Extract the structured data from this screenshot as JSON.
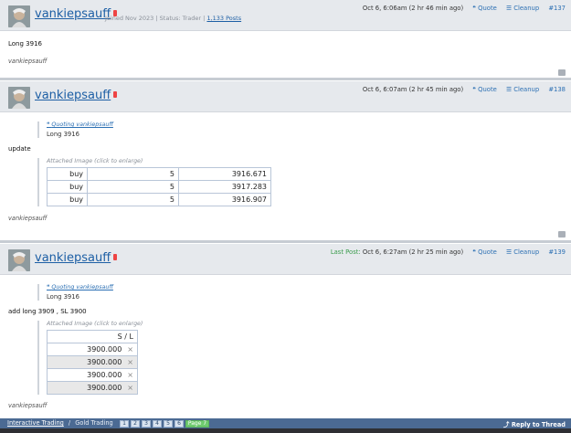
{
  "post1": {
    "username": "vankiepsauff",
    "joined": "Joined Nov 2023",
    "status": "Status: Trader",
    "posts": "1,133 Posts",
    "timestamp": "Oct 6, 6:06am (2 hr 46 min ago)",
    "quote_label": "Quote",
    "cleanup_label": "Cleanup",
    "post_number": "#137",
    "content": "Long 3916",
    "signature": "vankiepsauff"
  },
  "post2": {
    "username": "vankiepsauff",
    "timestamp": "Oct 6, 6:07am (2 hr 45 min ago)",
    "quote_label": "Quote",
    "cleanup_label": "Cleanup",
    "post_number": "#138",
    "quoting": "Quoting vankiepsauff",
    "quoted_text": "Long 3916",
    "content": "update",
    "attached_label": "Attached Image (click to enlarge)",
    "table": [
      [
        "buy",
        "5",
        "3916.671"
      ],
      [
        "buy",
        "5",
        "3917.283"
      ],
      [
        "buy",
        "5",
        "3916.907"
      ]
    ],
    "signature": "vankiepsauff"
  },
  "post3": {
    "username": "vankiepsauff",
    "last_post_label": "Last Post:",
    "timestamp": "Oct 6, 6:27am (2 hr 25 min ago)",
    "quote_label": "Quote",
    "cleanup_label": "Cleanup",
    "post_number": "#139",
    "quoting": "Quoting vankiepsauff",
    "quoted_text": "Long 3916",
    "content": "add long 3909 , SL 3900",
    "attached_label": "Attached Image (click to enlarge)",
    "sl_header": "S / L",
    "sl_rows": [
      "3900.000",
      "3900.000",
      "3900.000",
      "3900.000"
    ],
    "sl_close": "×",
    "signature": "vankiepsauff"
  },
  "footer": {
    "crumb_1": "Interactive Trading",
    "crumb_sep": "/",
    "crumb_2": "Gold Trading",
    "pages": [
      "1",
      "2",
      "3",
      "4",
      "5",
      "6"
    ],
    "current_page": "Page 7",
    "reply": "Reply to Thread"
  },
  "colors": {
    "link": "#1d5fa5",
    "header_bg": "#e6e9ed",
    "footer_bg": "#4b6a93",
    "current_page": "#6fcb6f",
    "last_post": "#3b9c4d"
  }
}
